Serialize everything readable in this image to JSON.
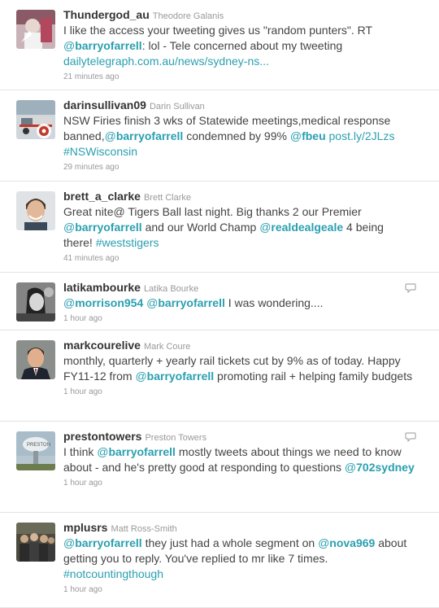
{
  "tweets": [
    {
      "screen_name": "Thundergod_au",
      "full_name": "Theodore Galanis",
      "segments": [
        {
          "type": "text",
          "value": "I like the access your tweeting gives us \"random punters\". RT "
        },
        {
          "type": "mention",
          "value": "barryofarrell"
        },
        {
          "type": "text",
          "value": ": lol - Tele concerned about my tweeting "
        },
        {
          "type": "link",
          "value": "dailytelegraph.com.au/news/sydney-ns..."
        }
      ],
      "time": "21 minutes ago",
      "has_reply_icon": false,
      "avatar_icon": "avatar-photo-person-icon"
    },
    {
      "screen_name": "darinsullivan09",
      "full_name": "Darin Sullivan",
      "segments": [
        {
          "type": "text",
          "value": "NSW Firies finish 3 wks of Statewide meetings,medical response banned,"
        },
        {
          "type": "mention",
          "value": "barryofarrell"
        },
        {
          "type": "text",
          "value": " condemned by 99% "
        },
        {
          "type": "mention",
          "value": "fbeu"
        },
        {
          "type": "text",
          "value": " "
        },
        {
          "type": "link",
          "value": "post.ly/2JLzs"
        },
        {
          "type": "text",
          "value": " "
        },
        {
          "type": "hashtag",
          "value": "#NSWisconsin"
        }
      ],
      "time": "29 minutes ago",
      "has_reply_icon": false,
      "avatar_icon": "avatar-fire-truck-icon"
    },
    {
      "screen_name": "brett_a_clarke",
      "full_name": "Brett Clarke",
      "segments": [
        {
          "type": "text",
          "value": "Great nite@ Tigers Ball last night. Big thanks 2 our Premier "
        },
        {
          "type": "mention",
          "value": "barryofarrell"
        },
        {
          "type": "text",
          "value": " and our World Champ "
        },
        {
          "type": "mention",
          "value": "realdealgeale"
        },
        {
          "type": "text",
          "value": " 4 being there! "
        },
        {
          "type": "hashtag",
          "value": "#weststigers"
        }
      ],
      "time": "41 minutes ago",
      "has_reply_icon": false,
      "avatar_icon": "avatar-photo-person-icon"
    },
    {
      "screen_name": "latikambourke",
      "full_name": "Latika Bourke",
      "segments": [
        {
          "type": "mention",
          "value": "morrison954"
        },
        {
          "type": "text",
          "value": " "
        },
        {
          "type": "mention",
          "value": "barryofarrell"
        },
        {
          "type": "text",
          "value": " I was wondering...."
        }
      ],
      "time": "1 hour ago",
      "has_reply_icon": true,
      "avatar_icon": "avatar-photo-person-icon"
    },
    {
      "screen_name": "markcourelive",
      "full_name": "Mark Coure",
      "segments": [
        {
          "type": "text",
          "value": "monthly, quarterly + yearly rail tickets cut by 9% as of today. Happy FY11-12 from "
        },
        {
          "type": "mention",
          "value": "barryofarrell"
        },
        {
          "type": "text",
          "value": " promoting rail + helping family budgets"
        }
      ],
      "time": "1 hour ago",
      "has_reply_icon": false,
      "avatar_icon": "avatar-photo-person-icon"
    },
    {
      "screen_name": "prestontowers",
      "full_name": "Preston Towers",
      "segments": [
        {
          "type": "text",
          "value": "I think "
        },
        {
          "type": "mention",
          "value": "barryofarrell"
        },
        {
          "type": "text",
          "value": " mostly tweets about things we need to know about - and he's pretty good at responding to questions "
        },
        {
          "type": "mention",
          "value": "702sydney"
        }
      ],
      "time": "1 hour ago",
      "has_reply_icon": true,
      "avatar_icon": "avatar-water-tower-icon"
    },
    {
      "screen_name": "mplusrs",
      "full_name": "Matt Ross-Smith",
      "segments": [
        {
          "type": "mention",
          "value": "barryofarrell"
        },
        {
          "type": "text",
          "value": " they just had a whole segment on "
        },
        {
          "type": "mention",
          "value": "nova969"
        },
        {
          "type": "text",
          "value": " about getting you to reply. You've replied to mr like 7 times. "
        },
        {
          "type": "hashtag",
          "value": "#notcountingthough"
        }
      ],
      "time": "1 hour ago",
      "has_reply_icon": false,
      "avatar_icon": "avatar-group-photo-icon"
    }
  ],
  "colors": {
    "link": "#2a9fb0",
    "meta": "#999999",
    "text": "#444444",
    "divider": "#e3e3e3"
  },
  "labels": {
    "reply_icon": "reply-icon",
    "mention_prefix": "@"
  }
}
